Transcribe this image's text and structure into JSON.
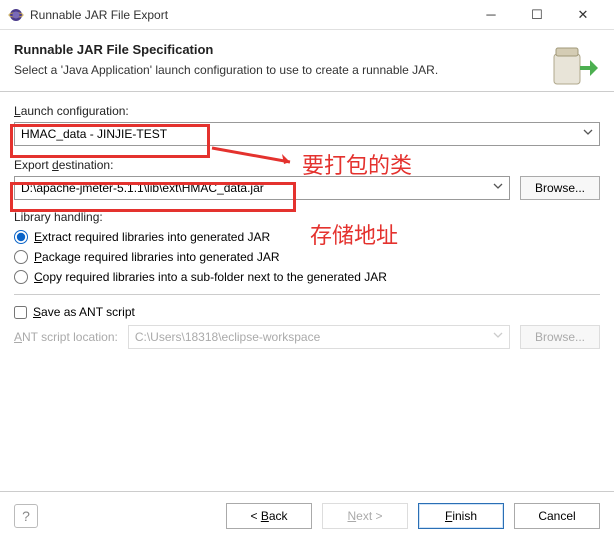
{
  "titlebar": {
    "title": "Runnable JAR File Export"
  },
  "header": {
    "title": "Runnable JAR File Specification",
    "subtitle": "Select a 'Java Application' launch configuration to use to create a runnable JAR."
  },
  "launch_config": {
    "label": "Launch configuration:",
    "value": "HMAC_data - JINJIE-TEST"
  },
  "export_dest": {
    "label": "Export destination:",
    "value": "D:\\apache-jmeter-5.1.1\\lib\\ext\\HMAC_data.jar",
    "browse": "Browse..."
  },
  "library": {
    "label": "Library handling:",
    "opt1": "Extract required libraries into generated JAR",
    "opt2": "Package required libraries into generated JAR",
    "opt3": "Copy required libraries into a sub-folder next to the generated JAR"
  },
  "ant": {
    "save_label": "Save as ANT script",
    "loc_label": "ANT script location:",
    "loc_value": "C:\\Users\\18318\\eclipse-workspace",
    "browse": "Browse..."
  },
  "buttons": {
    "back": "< Back",
    "next": "Next >",
    "finish": "Finish",
    "cancel": "Cancel"
  },
  "annotations": {
    "a1": "要打包的类",
    "a2": "存储地址"
  }
}
